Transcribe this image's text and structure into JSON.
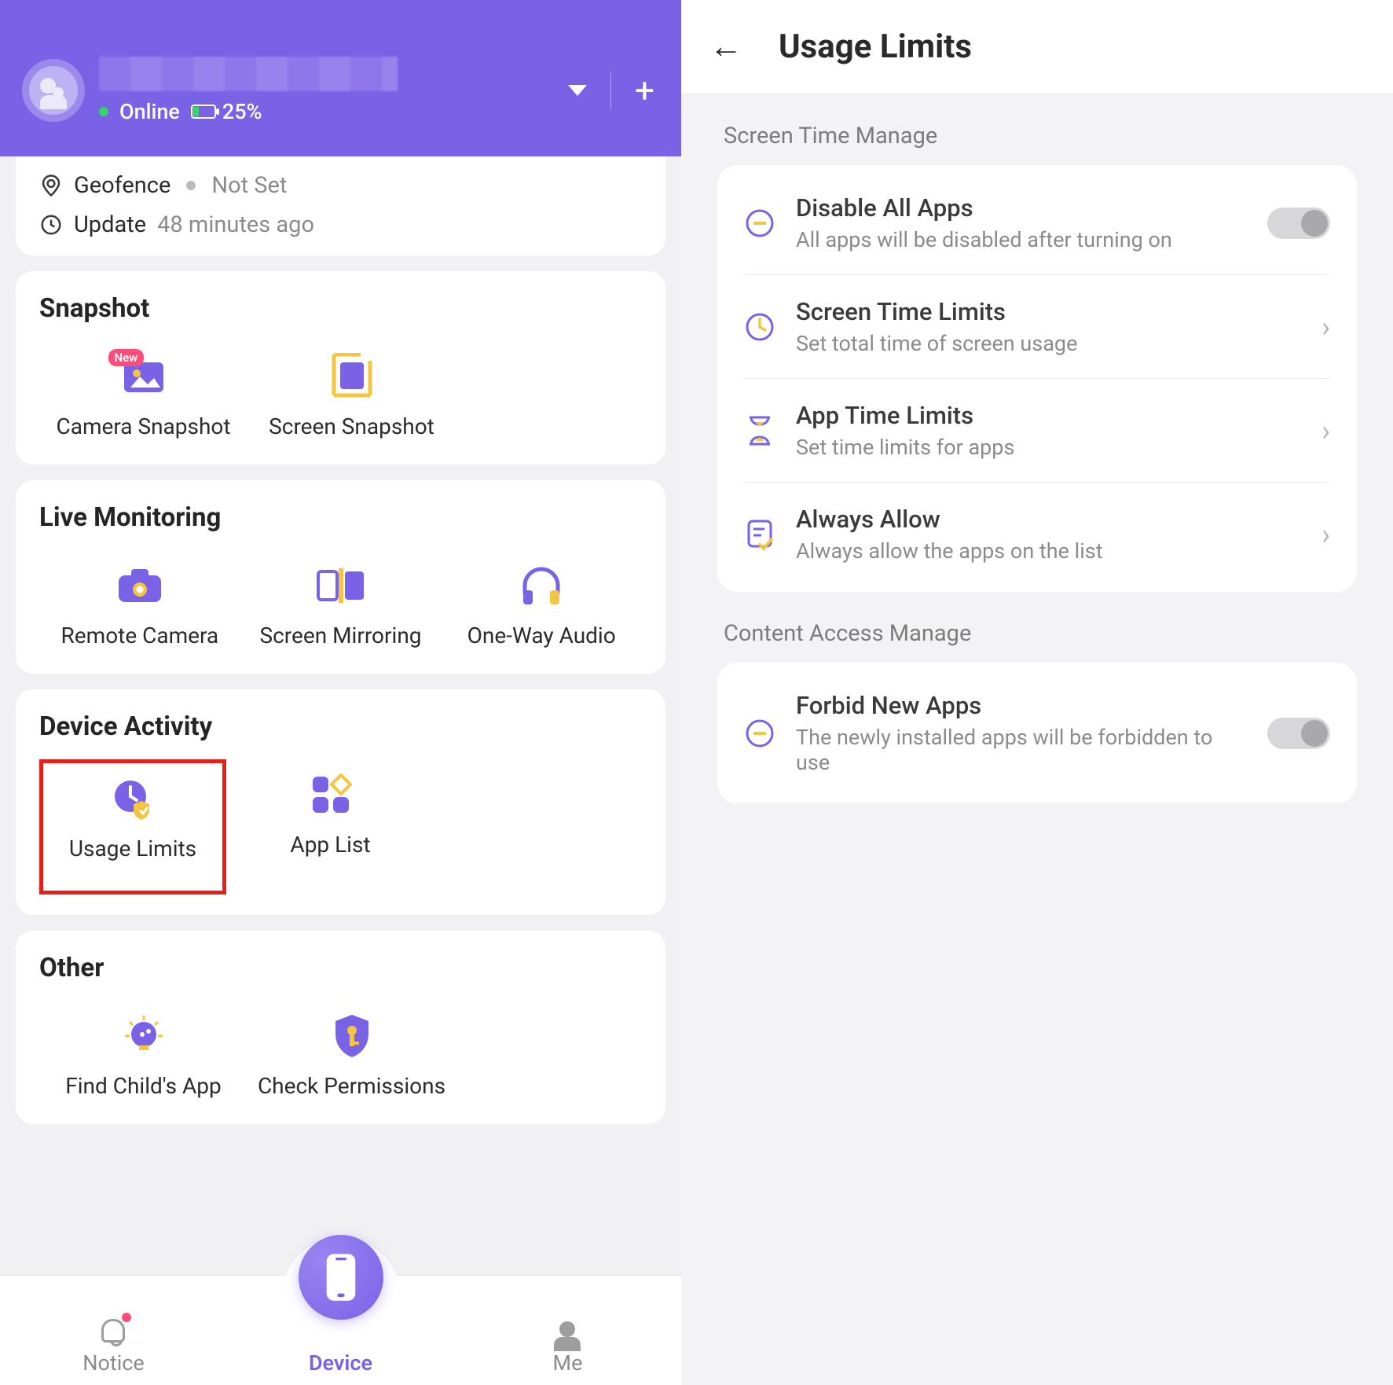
{
  "left": {
    "status": "Online",
    "battery": "25%",
    "geofence_label": "Geofence",
    "geofence_value": "Not Set",
    "update_label": "Update",
    "update_value": "48 minutes ago",
    "sections": {
      "snapshot": {
        "title": "Snapshot",
        "items": [
          {
            "label": "Camera Snapshot",
            "badge": "New",
            "icon": "camera-photo-icon"
          },
          {
            "label": "Screen Snapshot",
            "icon": "screen-crop-icon"
          }
        ]
      },
      "live": {
        "title": "Live Monitoring",
        "items": [
          {
            "label": "Remote Camera",
            "icon": "camera-icon"
          },
          {
            "label": "Screen Mirroring",
            "icon": "mirror-icon"
          },
          {
            "label": "One-Way Audio",
            "icon": "headphones-icon"
          }
        ]
      },
      "activity": {
        "title": "Device Activity",
        "items": [
          {
            "label": "Usage Limits",
            "icon": "clock-shield-icon",
            "highlight": true
          },
          {
            "label": "App List",
            "icon": "apps-icon"
          }
        ]
      },
      "other": {
        "title": "Other",
        "items": [
          {
            "label": "Find Child's App",
            "icon": "bulb-child-icon"
          },
          {
            "label": "Check Permissions",
            "icon": "shield-key-icon"
          }
        ]
      }
    },
    "nav": {
      "notice": "Notice",
      "device": "Device",
      "me": "Me"
    }
  },
  "right": {
    "title": "Usage Limits",
    "section1": "Screen Time Manage",
    "section2": "Content Access Manage",
    "rows": {
      "disable_all": {
        "title": "Disable All Apps",
        "sub": "All apps will be disabled after turning on",
        "type": "toggle"
      },
      "screen_time": {
        "title": "Screen Time Limits",
        "sub": "Set total time of screen usage",
        "type": "nav"
      },
      "app_time": {
        "title": "App Time Limits",
        "sub": "Set time limits for apps",
        "type": "nav"
      },
      "always_allow": {
        "title": "Always Allow",
        "sub": "Always allow the apps on the list",
        "type": "nav"
      },
      "forbid_new": {
        "title": "Forbid New Apps",
        "sub": "The newly installed apps will be forbidden to use",
        "type": "toggle"
      }
    }
  }
}
